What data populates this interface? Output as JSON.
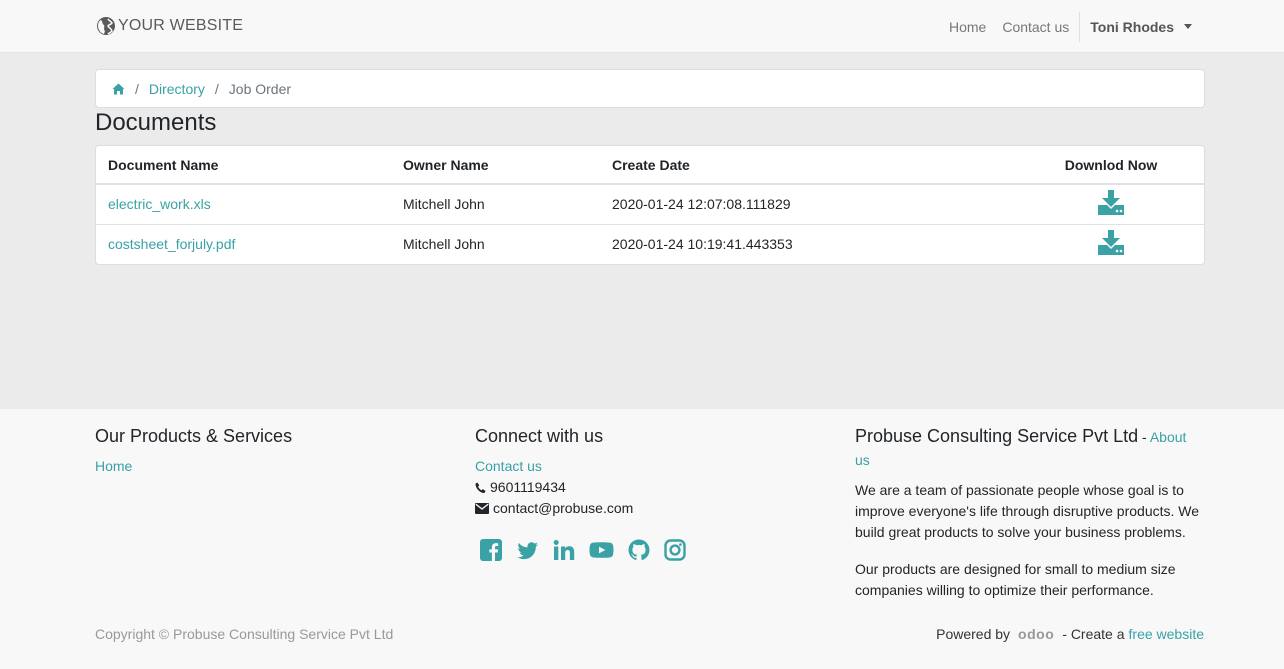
{
  "navbar": {
    "brand": "YOUR WEBSITE",
    "links": [
      "Home",
      "Contact us"
    ],
    "user": "Toni Rhodes"
  },
  "breadcrumb": {
    "home_icon": "home-icon",
    "directory": "Directory",
    "current": "Job Order"
  },
  "page": {
    "title": "Documents"
  },
  "table": {
    "headers": [
      "Document Name",
      "Owner Name",
      "Create Date",
      "Downlod Now"
    ],
    "rows": [
      {
        "name": "electric_work.xls",
        "owner": "Mitchell John",
        "date": "2020-01-24 12:07:08.111829"
      },
      {
        "name": "costsheet_forjuly.pdf",
        "owner": "Mitchell John",
        "date": "2020-01-24 10:19:41.443353"
      }
    ]
  },
  "footer": {
    "col1": {
      "title": "Our Products & Services",
      "link": "Home"
    },
    "col2": {
      "title": "Connect with us",
      "contact_link": "Contact us",
      "phone": "9601119434",
      "email": "contact@probuse.com",
      "social": [
        "facebook-icon",
        "twitter-icon",
        "linkedin-icon",
        "youtube-icon",
        "github-icon",
        "instagram-icon"
      ]
    },
    "col3": {
      "title": "Probuse Consulting Service Pvt Ltd",
      "title_sep": " - ",
      "about": "About us",
      "p1": "We are a team of passionate people whose goal is to improve everyone's life through disruptive products. We build great products to solve your business problems.",
      "p2": "Our products are designed for small to medium size companies willing to optimize their performance."
    },
    "copyright": "Copyright © Probuse Consulting Service Pvt Ltd",
    "powered_by": "Powered by",
    "odoo": "odoo",
    "create_text": "- Create a",
    "free_website": "free website"
  },
  "colors": {
    "accent": "#3aa1a5",
    "page_bg": "#ebebeb",
    "footer_bg": "#f8f8f8"
  }
}
